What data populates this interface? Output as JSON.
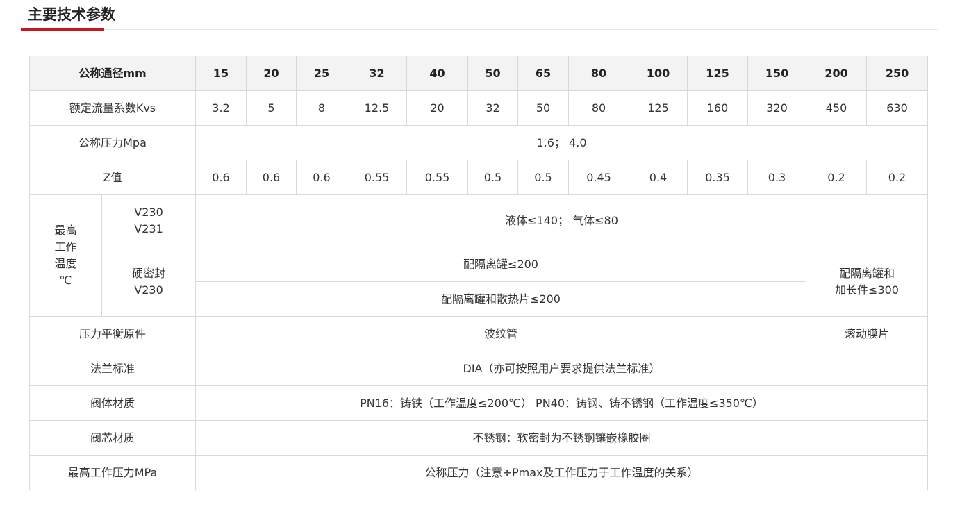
{
  "section": {
    "title": "主要技术参数"
  },
  "table": {
    "header": {
      "label": "公称通径mm",
      "sizes": [
        "15",
        "20",
        "25",
        "32",
        "40",
        "50",
        "65",
        "80",
        "100",
        "125",
        "150",
        "200",
        "250"
      ]
    },
    "kvs": {
      "label": "额定流量系数Kvs",
      "values": [
        "3.2",
        "5",
        "8",
        "12.5",
        "20",
        "32",
        "50",
        "80",
        "125",
        "160",
        "320",
        "450",
        "630"
      ]
    },
    "pressure": {
      "label": "公称压力Mpa",
      "value": "1.6； 4.0"
    },
    "z": {
      "label": "Z值",
      "values": [
        "0.6",
        "0.6",
        "0.6",
        "0.55",
        "0.55",
        "0.5",
        "0.5",
        "0.45",
        "0.4",
        "0.35",
        "0.3",
        "0.2",
        "0.2"
      ]
    },
    "temp": {
      "label_lines": [
        "最高",
        "工作",
        "温度",
        "℃"
      ],
      "soft_models": [
        "V230",
        "V231"
      ],
      "soft_value": "液体≤140； 气体≤80",
      "hard_lines": [
        "硬密封",
        "V230"
      ],
      "hard_value1": "配隔离罐≤200",
      "hard_value2": "配隔离罐和散热片≤200",
      "hard_side_lines": [
        "配隔离罐和",
        "加长件≤300"
      ]
    },
    "balance": {
      "label": "压力平衡原件",
      "value_main": "波纹管",
      "value_side": "滚动膜片"
    },
    "flange": {
      "label": "法兰标准",
      "value": "DIA（亦可按照用户要求提供法兰标准）"
    },
    "body_material": {
      "label": "阀体材质",
      "value": "PN16：铸铁（工作温度≤200℃） PN40：铸钢、铸不锈钢（工作温度≤350℃）"
    },
    "core_material": {
      "label": "阀芯材质",
      "value": "不锈钢：软密封为不锈钢镶嵌橡胶圈"
    },
    "max_pressure": {
      "label": "最高工作压力MPa",
      "value": "公称压力（注意÷Pmax及工作压力于工作温度的关系）"
    }
  }
}
